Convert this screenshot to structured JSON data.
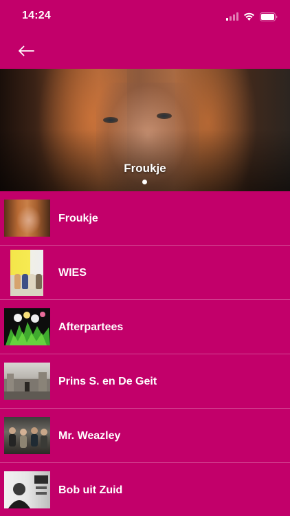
{
  "status_bar": {
    "time": "14:24",
    "icons": [
      "signal-icon",
      "wifi-icon",
      "battery-icon"
    ]
  },
  "nav": {
    "back_icon": "back-arrow-icon"
  },
  "hero": {
    "title": "Froukje",
    "page_indicator": {
      "current": 1,
      "total": 1
    }
  },
  "artists": [
    {
      "name": "Froukje"
    },
    {
      "name": "WIES"
    },
    {
      "name": "Afterpartees"
    },
    {
      "name": "Prins S. en De Geit"
    },
    {
      "name": "Mr. Weazley"
    },
    {
      "name": "Bob uit Zuid"
    }
  ],
  "colors": {
    "background": "#c2006a",
    "text": "#ffffff"
  }
}
